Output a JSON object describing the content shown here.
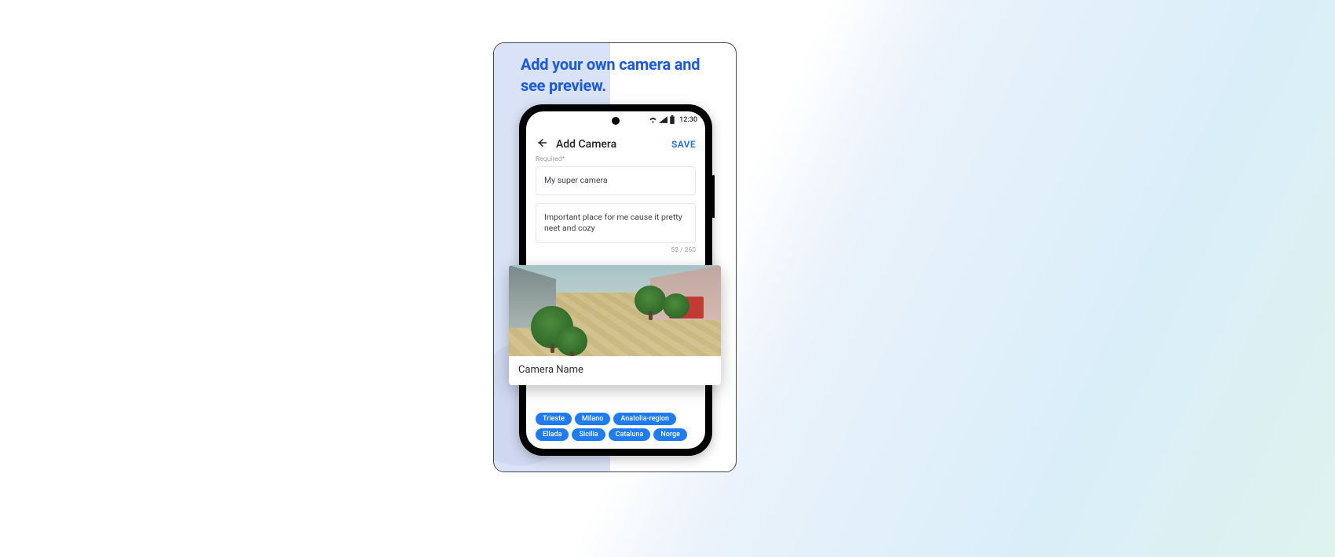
{
  "promo": {
    "headline": "Add your own  camera and see preview."
  },
  "status": {
    "time": "12:30"
  },
  "appbar": {
    "title": "Add Camera",
    "save_label": "SAVE"
  },
  "form": {
    "required_label": "Required*",
    "name_value": "My super camera",
    "desc_value": "Important place for me cause  it pretty neet and cozy",
    "char_counter": "52 / 260"
  },
  "chips": [
    "Trieste",
    "Milano",
    "Anatolia-region",
    "Ellada",
    "Sicilia",
    "Cataluna",
    "Norge"
  ],
  "preview": {
    "label": "Camera  Name"
  }
}
